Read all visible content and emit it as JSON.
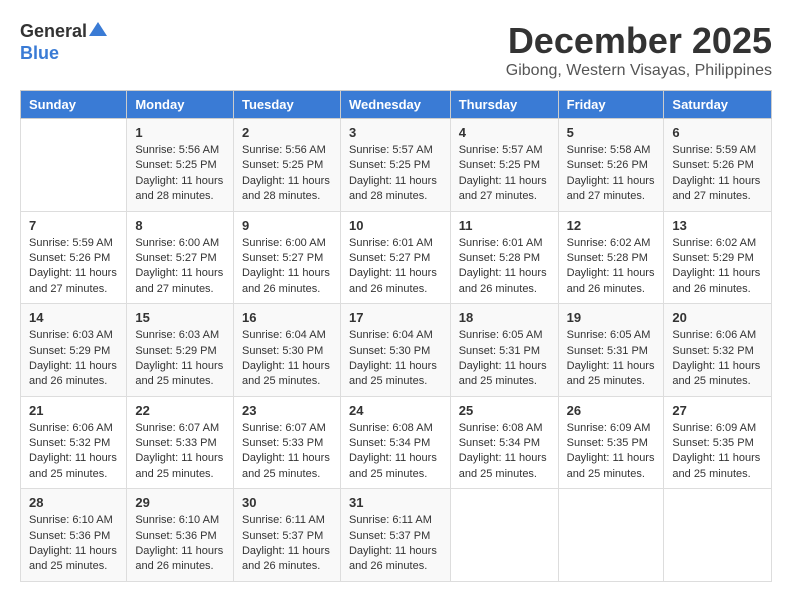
{
  "logo": {
    "general": "General",
    "blue": "Blue"
  },
  "title": {
    "month_year": "December 2025",
    "location": "Gibong, Western Visayas, Philippines"
  },
  "weekdays": [
    "Sunday",
    "Monday",
    "Tuesday",
    "Wednesday",
    "Thursday",
    "Friday",
    "Saturday"
  ],
  "weeks": [
    [
      {
        "day": "",
        "info": ""
      },
      {
        "day": "1",
        "info": "Sunrise: 5:56 AM\nSunset: 5:25 PM\nDaylight: 11 hours\nand 28 minutes."
      },
      {
        "day": "2",
        "info": "Sunrise: 5:56 AM\nSunset: 5:25 PM\nDaylight: 11 hours\nand 28 minutes."
      },
      {
        "day": "3",
        "info": "Sunrise: 5:57 AM\nSunset: 5:25 PM\nDaylight: 11 hours\nand 28 minutes."
      },
      {
        "day": "4",
        "info": "Sunrise: 5:57 AM\nSunset: 5:25 PM\nDaylight: 11 hours\nand 27 minutes."
      },
      {
        "day": "5",
        "info": "Sunrise: 5:58 AM\nSunset: 5:26 PM\nDaylight: 11 hours\nand 27 minutes."
      },
      {
        "day": "6",
        "info": "Sunrise: 5:59 AM\nSunset: 5:26 PM\nDaylight: 11 hours\nand 27 minutes."
      }
    ],
    [
      {
        "day": "7",
        "info": "Sunrise: 5:59 AM\nSunset: 5:26 PM\nDaylight: 11 hours\nand 27 minutes."
      },
      {
        "day": "8",
        "info": "Sunrise: 6:00 AM\nSunset: 5:27 PM\nDaylight: 11 hours\nand 27 minutes."
      },
      {
        "day": "9",
        "info": "Sunrise: 6:00 AM\nSunset: 5:27 PM\nDaylight: 11 hours\nand 26 minutes."
      },
      {
        "day": "10",
        "info": "Sunrise: 6:01 AM\nSunset: 5:27 PM\nDaylight: 11 hours\nand 26 minutes."
      },
      {
        "day": "11",
        "info": "Sunrise: 6:01 AM\nSunset: 5:28 PM\nDaylight: 11 hours\nand 26 minutes."
      },
      {
        "day": "12",
        "info": "Sunrise: 6:02 AM\nSunset: 5:28 PM\nDaylight: 11 hours\nand 26 minutes."
      },
      {
        "day": "13",
        "info": "Sunrise: 6:02 AM\nSunset: 5:29 PM\nDaylight: 11 hours\nand 26 minutes."
      }
    ],
    [
      {
        "day": "14",
        "info": "Sunrise: 6:03 AM\nSunset: 5:29 PM\nDaylight: 11 hours\nand 26 minutes."
      },
      {
        "day": "15",
        "info": "Sunrise: 6:03 AM\nSunset: 5:29 PM\nDaylight: 11 hours\nand 25 minutes."
      },
      {
        "day": "16",
        "info": "Sunrise: 6:04 AM\nSunset: 5:30 PM\nDaylight: 11 hours\nand 25 minutes."
      },
      {
        "day": "17",
        "info": "Sunrise: 6:04 AM\nSunset: 5:30 PM\nDaylight: 11 hours\nand 25 minutes."
      },
      {
        "day": "18",
        "info": "Sunrise: 6:05 AM\nSunset: 5:31 PM\nDaylight: 11 hours\nand 25 minutes."
      },
      {
        "day": "19",
        "info": "Sunrise: 6:05 AM\nSunset: 5:31 PM\nDaylight: 11 hours\nand 25 minutes."
      },
      {
        "day": "20",
        "info": "Sunrise: 6:06 AM\nSunset: 5:32 PM\nDaylight: 11 hours\nand 25 minutes."
      }
    ],
    [
      {
        "day": "21",
        "info": "Sunrise: 6:06 AM\nSunset: 5:32 PM\nDaylight: 11 hours\nand 25 minutes."
      },
      {
        "day": "22",
        "info": "Sunrise: 6:07 AM\nSunset: 5:33 PM\nDaylight: 11 hours\nand 25 minutes."
      },
      {
        "day": "23",
        "info": "Sunrise: 6:07 AM\nSunset: 5:33 PM\nDaylight: 11 hours\nand 25 minutes."
      },
      {
        "day": "24",
        "info": "Sunrise: 6:08 AM\nSunset: 5:34 PM\nDaylight: 11 hours\nand 25 minutes."
      },
      {
        "day": "25",
        "info": "Sunrise: 6:08 AM\nSunset: 5:34 PM\nDaylight: 11 hours\nand 25 minutes."
      },
      {
        "day": "26",
        "info": "Sunrise: 6:09 AM\nSunset: 5:35 PM\nDaylight: 11 hours\nand 25 minutes."
      },
      {
        "day": "27",
        "info": "Sunrise: 6:09 AM\nSunset: 5:35 PM\nDaylight: 11 hours\nand 25 minutes."
      }
    ],
    [
      {
        "day": "28",
        "info": "Sunrise: 6:10 AM\nSunset: 5:36 PM\nDaylight: 11 hours\nand 25 minutes."
      },
      {
        "day": "29",
        "info": "Sunrise: 6:10 AM\nSunset: 5:36 PM\nDaylight: 11 hours\nand 26 minutes."
      },
      {
        "day": "30",
        "info": "Sunrise: 6:11 AM\nSunset: 5:37 PM\nDaylight: 11 hours\nand 26 minutes."
      },
      {
        "day": "31",
        "info": "Sunrise: 6:11 AM\nSunset: 5:37 PM\nDaylight: 11 hours\nand 26 minutes."
      },
      {
        "day": "",
        "info": ""
      },
      {
        "day": "",
        "info": ""
      },
      {
        "day": "",
        "info": ""
      }
    ]
  ]
}
